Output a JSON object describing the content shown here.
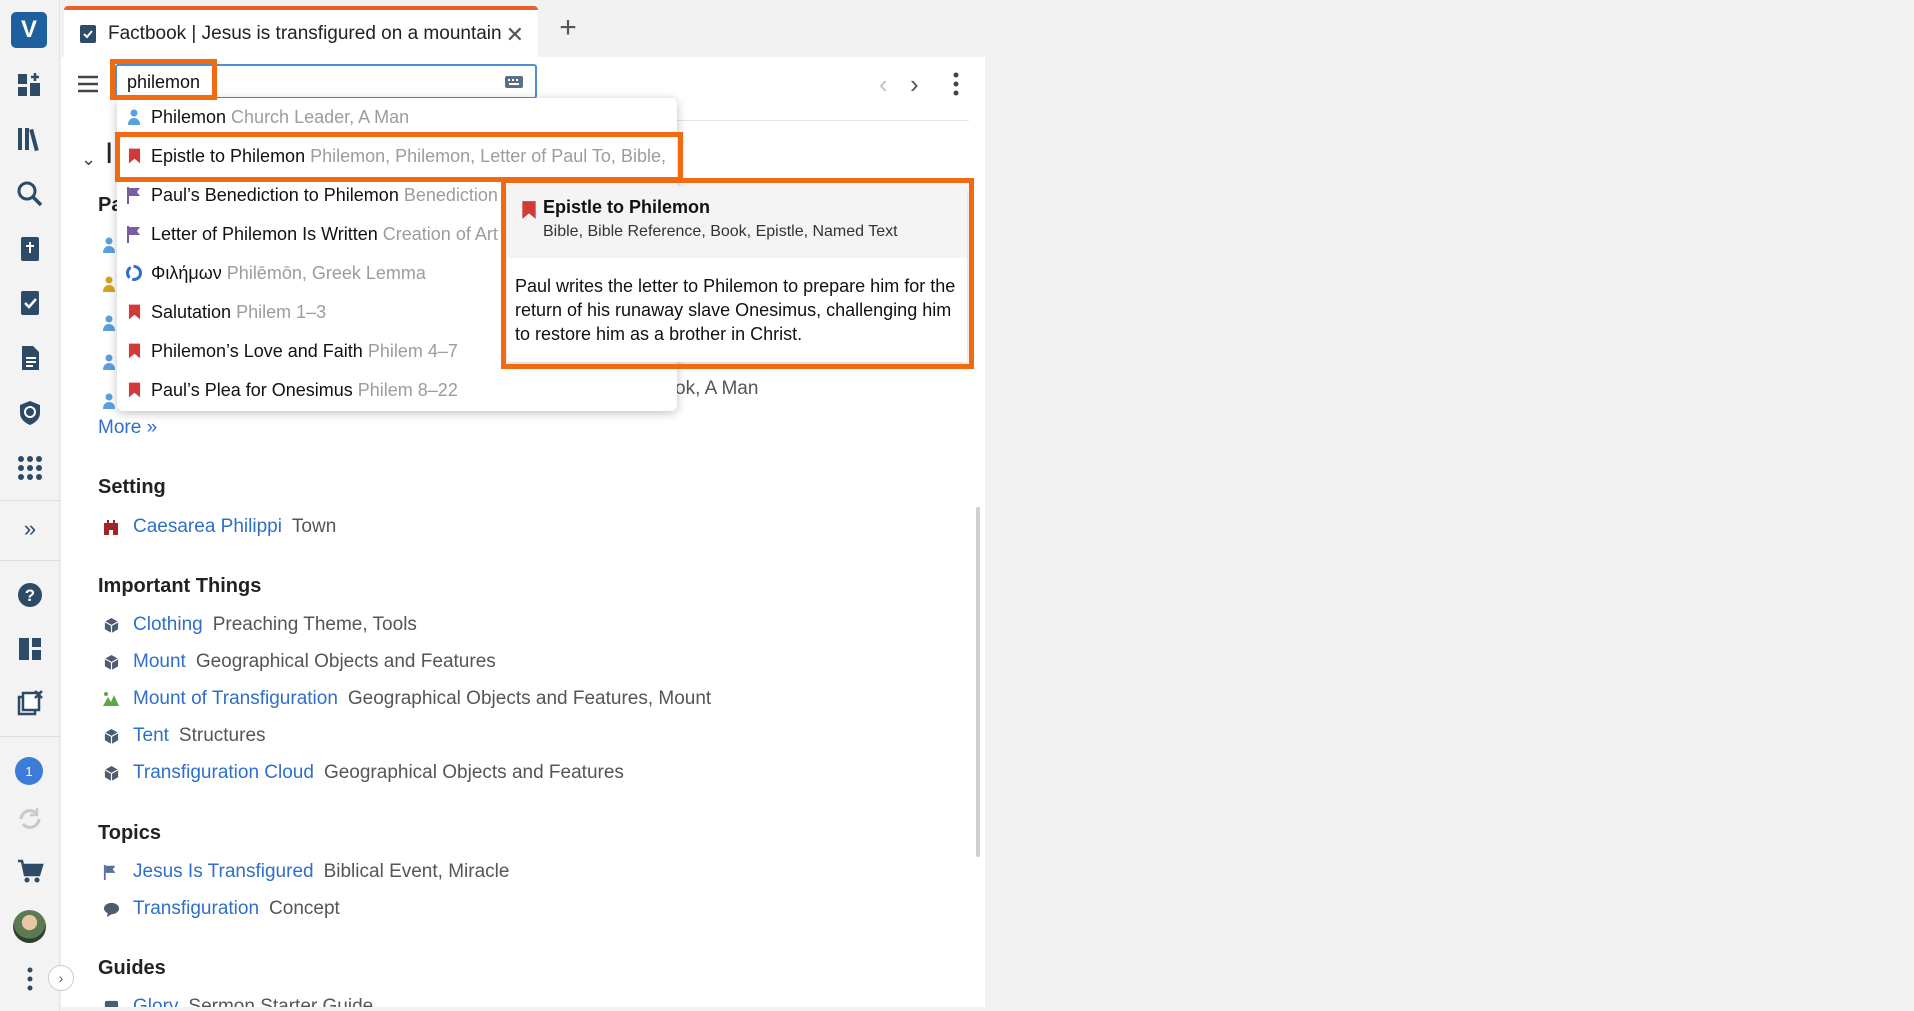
{
  "app": {
    "colors": {
      "accent": "#e8612c",
      "highlight": "#f06a12",
      "link": "#2f6fc9"
    }
  },
  "rail": {
    "icons": [
      "logos-logo-icon",
      "dashboard-add-icon",
      "library-icon",
      "search-icon",
      "bible-icon",
      "factbook-icon",
      "document-icon",
      "study-icon",
      "apps-grid-icon",
      "expand-icon",
      "help-icon",
      "layouts-icon",
      "close-panels-icon",
      "notifications-icon",
      "sync-icon",
      "cart-icon",
      "avatar",
      "more-icon"
    ],
    "notification_count": "1"
  },
  "tab": {
    "title": "Factbook | Jesus is transfigured on a mountain",
    "close": "✕",
    "new_tab": "+"
  },
  "toolbar": {
    "search_value": "philemon"
  },
  "dropdown": {
    "items": [
      {
        "name": "Philemon",
        "meta": "Church Leader, A Man",
        "icon": "person-icon"
      },
      {
        "name": "Epistle to Philemon",
        "meta": "Philemon, Philemon, Letter of Paul To, Bible,",
        "icon": "bookmark-icon"
      },
      {
        "name": "Paul’s Benediction to Philemon",
        "meta": "Benediction",
        "icon": "flag-icon"
      },
      {
        "name": "Letter of Philemon Is Written",
        "meta": "Creation of Art",
        "icon": "flag-icon"
      },
      {
        "name": "Φιλήμων",
        "meta": "Philēmōn, Greek Lemma",
        "icon": "lemma-icon"
      },
      {
        "name": "Salutation",
        "meta": "Philem 1–3",
        "icon": "bookmark-icon"
      },
      {
        "name": "Philemon’s Love and Faith",
        "meta": "Philem 4–7",
        "icon": "bookmark-icon"
      },
      {
        "name": "Paul’s Plea for Onesimus",
        "meta": "Philem 8–22",
        "icon": "bookmark-icon"
      }
    ]
  },
  "preview": {
    "title": "Epistle to Philemon",
    "types": "Bible, Bible Reference, Book, Epistle, Named Text",
    "description": "Paul writes the letter to Philemon to prepare him for the return of his runaway slave Onesimus, challenging him to restore him as a brother in Christ."
  },
  "content": {
    "dup_heading_partial": "I",
    "people_heading_partial": "Pa",
    "partial_row_1": "(cut off group label)",
    "partial_row_2": "ok, A Man",
    "more": "More »",
    "setting": {
      "title": "Setting",
      "items": [
        {
          "link": "Caesarea Philippi",
          "desc": "Town"
        }
      ]
    },
    "important": {
      "title": "Important Things",
      "items": [
        {
          "link": "Clothing",
          "desc": "Preaching Theme, Tools"
        },
        {
          "link": "Mount",
          "desc": "Geographical Objects and Features"
        },
        {
          "link": "Mount of Transfiguration",
          "desc": "Geographical Objects and Features, Mount"
        },
        {
          "link": "Tent",
          "desc": "Structures"
        },
        {
          "link": "Transfiguration Cloud",
          "desc": "Geographical Objects and Features"
        }
      ]
    },
    "topics": {
      "title": "Topics",
      "items": [
        {
          "link": "Jesus Is Transfigured",
          "desc": "Biblical Event, Miracle"
        },
        {
          "link": "Transfiguration",
          "desc": "Concept"
        }
      ]
    },
    "guides": {
      "title": "Guides",
      "items": [
        {
          "link": "Glory",
          "desc": "Sermon Starter Guide"
        }
      ]
    }
  }
}
